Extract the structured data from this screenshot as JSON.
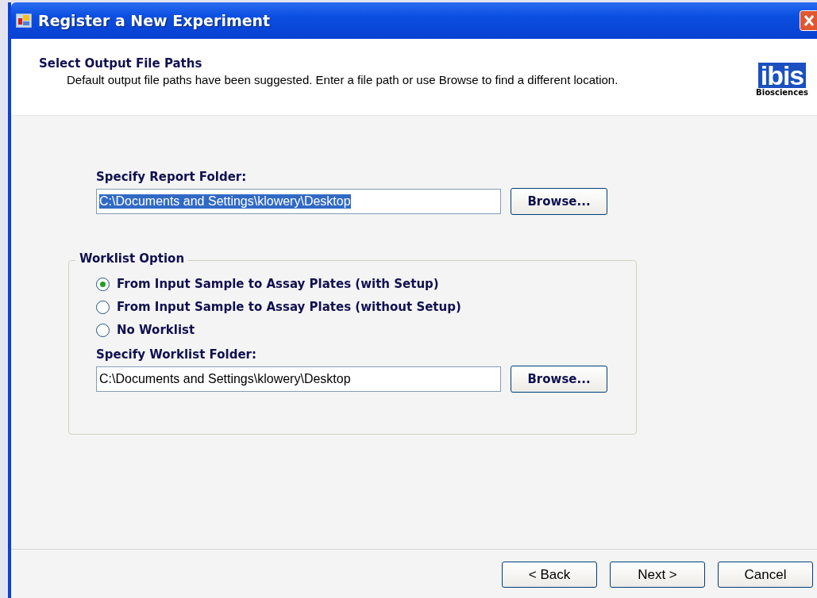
{
  "window": {
    "title": "Register a New Experiment"
  },
  "header": {
    "title": "Select Output File Paths",
    "description": "Default output file paths have been suggested.  Enter a file path or use Browse to find a different location.",
    "logo": {
      "name": "ibis",
      "tagline": "Biosciences"
    }
  },
  "report": {
    "label": "Specify Report Folder:",
    "value": "C:\\Documents and Settings\\klowery\\Desktop",
    "text_selected": true,
    "button": "Browse..."
  },
  "worklist": {
    "legend": "Worklist Option",
    "options": [
      {
        "label": "From Input Sample to Assay Plates (with Setup)",
        "selected": true
      },
      {
        "label": "From Input Sample to Assay Plates (without Setup)",
        "selected": false
      },
      {
        "label": "No Worklist",
        "selected": false
      }
    ],
    "folder_label": "Specify Worklist Folder:",
    "value": "C:\\Documents and Settings\\klowery\\Desktop",
    "text_selected": false,
    "button": "Browse..."
  },
  "buttons": [
    "< Back",
    "Next >",
    "Cancel"
  ]
}
